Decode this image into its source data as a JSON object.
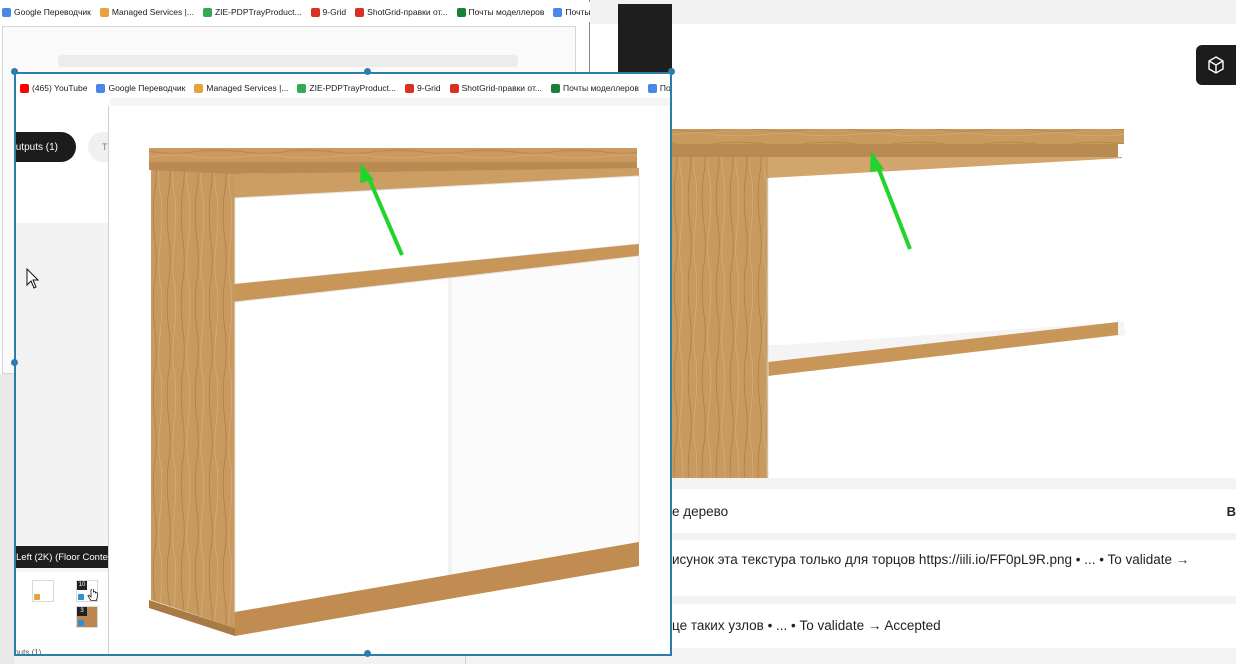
{
  "back_window": {
    "bookmarks": [
      {
        "label": "Google Переводчик",
        "color": "#4a86e8"
      },
      {
        "label": "Managed Services |...",
        "color": "#e9a23b"
      },
      {
        "label": "ZIE-PDPTrayProduct...",
        "color": "#34a853"
      },
      {
        "label": "9-Grid",
        "color": "#d93025"
      },
      {
        "label": "ShotGrid-правки от...",
        "color": "#d93025"
      },
      {
        "label": "Почты моделлеров",
        "color": "#188038"
      },
      {
        "label": "Почты визер",
        "color": "#4a86e8"
      }
    ]
  },
  "front_window": {
    "bookmarks": [
      {
        "label": "(465) YouTube",
        "color": "#ff0000"
      },
      {
        "label": "Google Переводчик",
        "color": "#4a86e8"
      },
      {
        "label": "Managed Services |...",
        "color": "#e9a23b"
      },
      {
        "label": "ZIE-PDPTrayProduct...",
        "color": "#34a853"
      },
      {
        "label": "9-Grid",
        "color": "#d93025"
      },
      {
        "label": "ShotGrid-правки от...",
        "color": "#d93025"
      },
      {
        "label": "Почты моделлеров",
        "color": "#188038"
      },
      {
        "label": "Почты",
        "color": "#4a86e8"
      }
    ],
    "outputs_label": "utputs (1)",
    "tab_ghost_label": "T",
    "tooltip": "Left (2K) (Floor Conte",
    "thumbs": [
      {
        "badge": ""
      },
      {
        "badge": "10"
      },
      {
        "badge": "3"
      }
    ],
    "outputs_footer": "tputs (1)"
  },
  "comments": [
    {
      "text": "е дерево",
      "icon": "B"
    },
    {
      "text": "исунок эта текстура только для торцов https://iili.io/FF0pL9R.png • ... • To validate →"
    },
    {
      "text": "це таких узлов • ... • To validate → Accepted"
    }
  ],
  "colors": {
    "wood": "#c9995e",
    "wood_dark": "#b5824a",
    "panel_white": "#ffffff",
    "arrow": "#22d32b",
    "selection": "#2c7dab"
  },
  "icons": {
    "viewer_button": "cube-icon",
    "cursor": "mouse-pointer-icon"
  }
}
